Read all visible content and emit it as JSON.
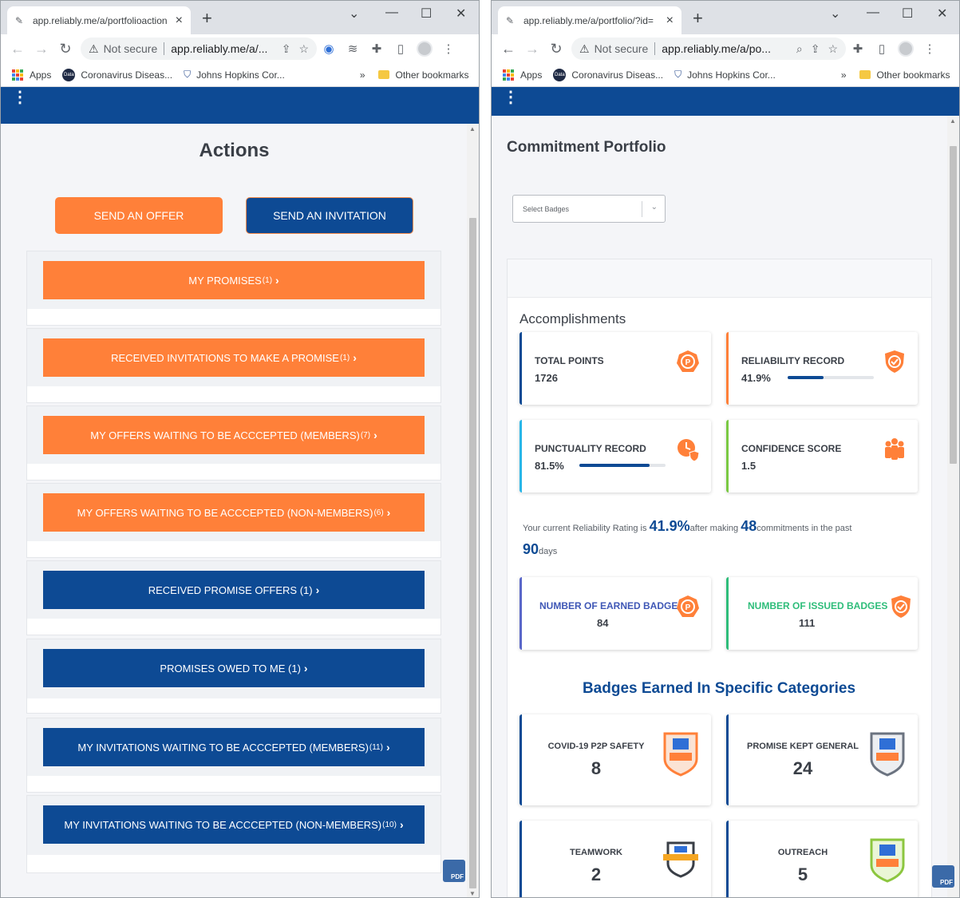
{
  "left_window": {
    "tab_title": "app.reliably.me/a/portfolioaction",
    "address": {
      "security": "Not secure",
      "url": "app.reliably.me/a/..."
    },
    "bookmarks": {
      "apps": "Apps",
      "b1": "Coronavirus Diseas...",
      "b2": "Johns Hopkins Cor...",
      "more": "»",
      "other": "Other bookmarks"
    },
    "page": {
      "title": "Actions",
      "send_offer": "SEND AN OFFER",
      "send_invitation": "SEND AN INVITATION",
      "actions": [
        {
          "label": "MY PROMISES",
          "count": "(1)"
        },
        {
          "label": "RECEIVED INVITATIONS TO MAKE A PROMISE",
          "count": "(1)"
        },
        {
          "label": "MY OFFERS WAITING TO BE ACCCEPTED (MEMBERS)",
          "count": "(7)"
        },
        {
          "label": "MY OFFERS WAITING TO BE ACCCEPTED (NON-MEMBERS)",
          "count": "(6)"
        },
        {
          "label": "RECEIVED PROMISE OFFERS (1)",
          "count": ""
        },
        {
          "label": "PROMISES OWED TO ME (1)",
          "count": ""
        },
        {
          "label": "MY INVITATIONS WAITING TO BE ACCCEPTED (MEMBERS)",
          "count": "(11)"
        },
        {
          "label": "MY INVITATIONS WAITING TO BE ACCCEPTED (NON-MEMBERS)",
          "count": "(10)"
        }
      ]
    }
  },
  "right_window": {
    "tab_title": "app.reliably.me/a/portfolio/?id=",
    "address": {
      "security": "Not secure",
      "url": "app.reliably.me/a/po..."
    },
    "bookmarks": {
      "apps": "Apps",
      "b1": "Coronavirus Diseas...",
      "b2": "Johns Hopkins Cor...",
      "more": "»",
      "other": "Other bookmarks"
    },
    "page": {
      "title": "Commitment Portfolio",
      "select_placeholder": "Select Badges",
      "accomplishments_title": "Accomplishments",
      "stats": {
        "total_points": {
          "label": "TOTAL POINTS",
          "value": "1726"
        },
        "reliability": {
          "label": "RELIABILITY RECORD",
          "value": "41.9%",
          "progress": 0.419
        },
        "punctuality": {
          "label": "PUNCTUALITY RECORD",
          "value": "81.5%",
          "progress": 0.815
        },
        "confidence": {
          "label": "CONFIDENCE SCORE",
          "value": "1.5"
        },
        "earned": {
          "label": "NUMBER OF EARNED BADGES",
          "value": "84"
        },
        "issued": {
          "label": "NUMBER OF ISSUED BADGES",
          "value": "111"
        }
      },
      "rating": {
        "p1": "Your current Reliability Rating is ",
        "pct": "41.9%",
        "p2": "after making ",
        "commitments": "48",
        "p3": "commitments in the past",
        "days": "90",
        "p4": "days"
      },
      "categories_title": "Badges Earned In Specific Categories",
      "categories": [
        {
          "label": "COVID-19 P2P SAFETY",
          "count": "8"
        },
        {
          "label": "PROMISE KEPT GENERAL",
          "count": "24"
        },
        {
          "label": "TEAMWORK",
          "count": "2"
        },
        {
          "label": "OUTREACH",
          "count": "5"
        }
      ]
    }
  },
  "colors": {
    "orange": "#ff8039",
    "navy": "#0d4a94",
    "green": "#2ebd7a"
  }
}
